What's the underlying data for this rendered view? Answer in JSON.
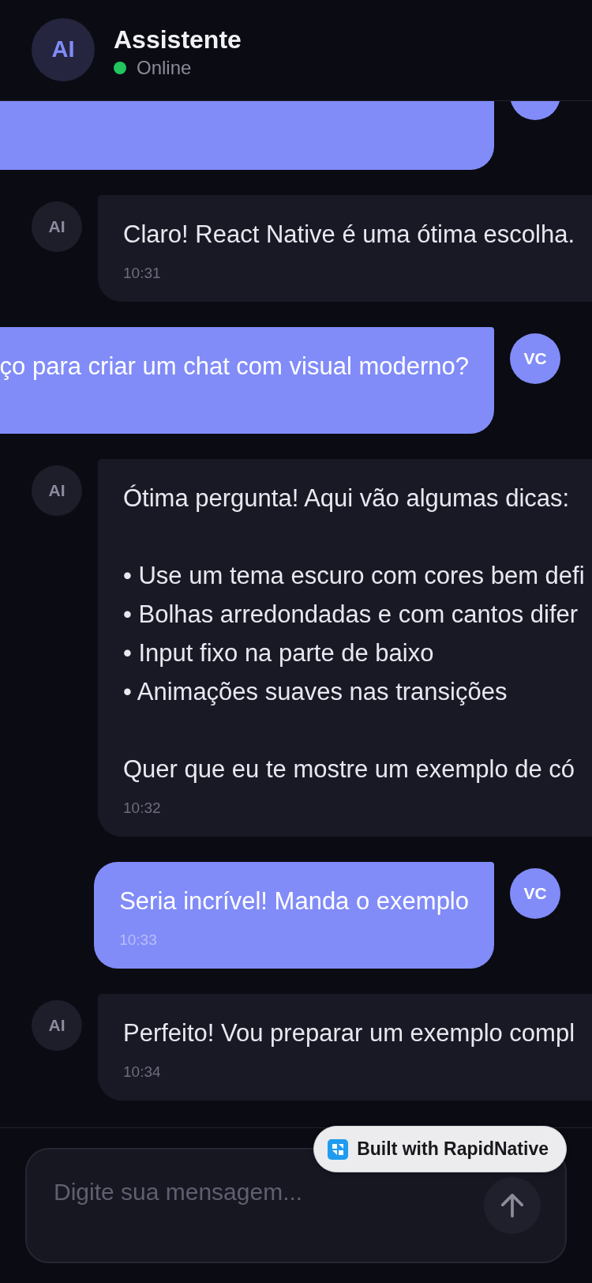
{
  "header": {
    "avatar": "AI",
    "title": "Assistente",
    "status": {
      "label": "Online",
      "online": true
    }
  },
  "messages": [
    {
      "kind": "user",
      "cut_off": true
    },
    {
      "kind": "assistant",
      "avatar": "AI",
      "text": "Claro! React Native é uma ótima escolha.",
      "time": "10:31",
      "cut_off": true
    },
    {
      "kind": "user",
      "avatar": "VC",
      "text": "ço para criar um chat com visual moderno?",
      "cut_off": true
    },
    {
      "kind": "assistant",
      "avatar": "AI",
      "text": "Ótima pergunta! Aqui vão algumas dicas:\n\n• Use um tema escuro com cores bem defi\n• Bolhas arredondadas e com cantos difer\n• Input fixo na parte de baixo\n• Animações suaves nas transições\n\nQuer que eu te mostre um exemplo de có",
      "time": "10:32",
      "cut_off": true
    },
    {
      "kind": "user",
      "avatar": "VC",
      "text": "Seria incrível! Manda o exemplo",
      "time": "10:33",
      "cut_off": false
    },
    {
      "kind": "assistant",
      "avatar": "AI",
      "text": "Perfeito! Vou preparar um exemplo compl",
      "time": "10:34",
      "cut_off": true
    }
  ],
  "composer": {
    "placeholder": "Digite sua mensagem..."
  },
  "badge": {
    "label": "Built with RapidNative"
  }
}
